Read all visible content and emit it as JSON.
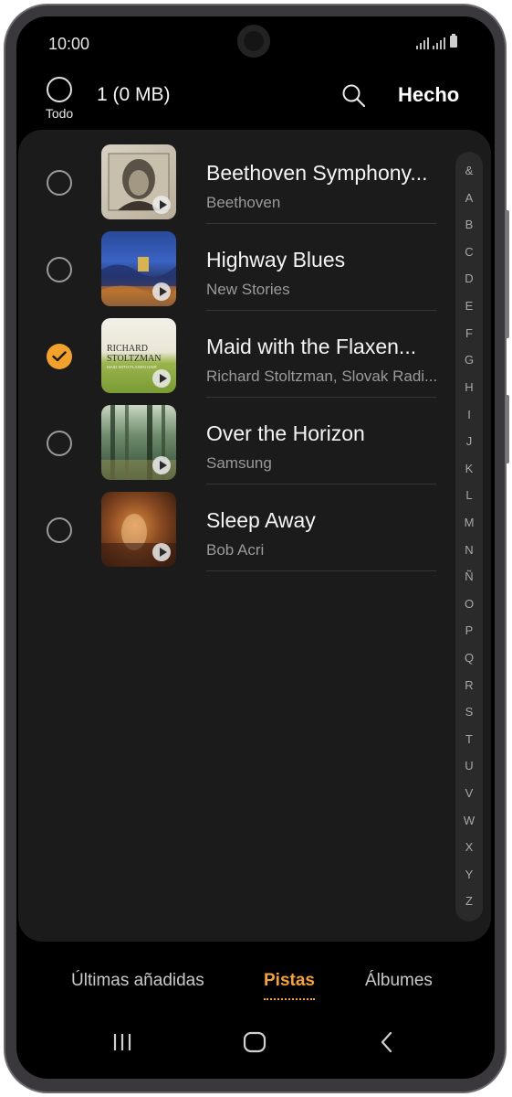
{
  "status_bar": {
    "time": "10:00"
  },
  "top_bar": {
    "select_all_label": "Todo",
    "selection_count": "1 (0 MB)",
    "done_label": "Hecho"
  },
  "tracks": [
    {
      "title": "Beethoven Symphony...",
      "artist": "Beethoven",
      "selected": false
    },
    {
      "title": "Highway Blues",
      "artist": "New Stories",
      "selected": false
    },
    {
      "title": "Maid with the Flaxen...",
      "artist": "Richard Stoltzman, Slovak Radi...",
      "selected": true
    },
    {
      "title": "Over the Horizon",
      "artist": "Samsung",
      "selected": false
    },
    {
      "title": "Sleep Away",
      "artist": "Bob Acri",
      "selected": false
    }
  ],
  "album_art_text": {
    "maid_line1": "RICHARD",
    "maid_line2": "STOLTZMAN",
    "maid_line3": "MAID WITH FLAXEN HAIR"
  },
  "index_letters": [
    "&",
    "A",
    "B",
    "C",
    "D",
    "E",
    "F",
    "G",
    "H",
    "I",
    "J",
    "K",
    "L",
    "M",
    "N",
    "Ñ",
    "O",
    "P",
    "Q",
    "R",
    "S",
    "T",
    "U",
    "V",
    "W",
    "X",
    "Y",
    "Z"
  ],
  "tabs": [
    {
      "label": "Últimas añadidas",
      "active": false
    },
    {
      "label": "Pistas",
      "active": true
    },
    {
      "label": "Álbumes",
      "active": false
    }
  ],
  "accent_color": "#f4a23a",
  "icons": [
    "search-icon",
    "check-icon",
    "play-icon",
    "recents-icon",
    "home-icon",
    "back-icon"
  ]
}
